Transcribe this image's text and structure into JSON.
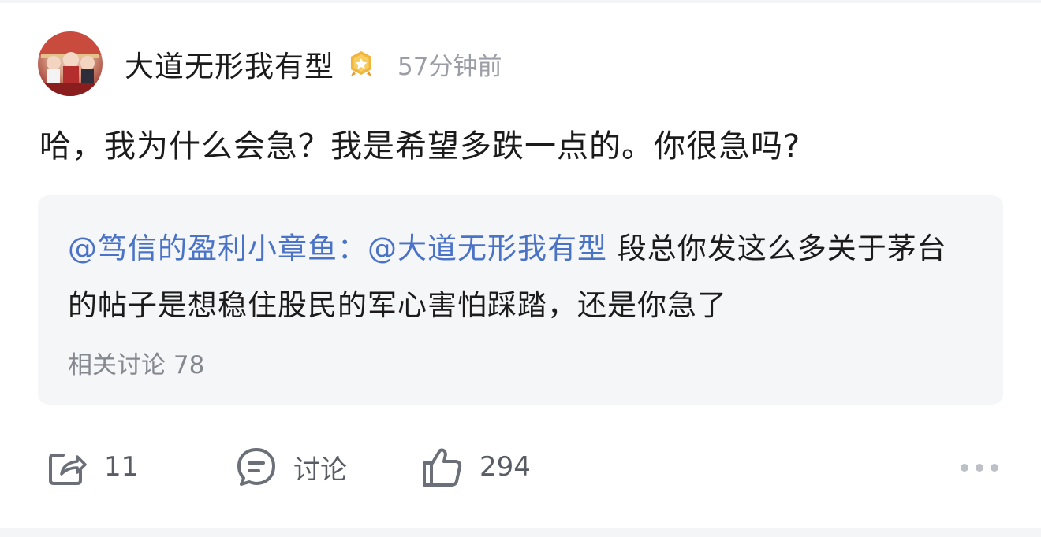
{
  "post": {
    "author": {
      "name": "大道无形我有型",
      "avatar_icon": "avatar-photo",
      "badge_icon": "vip-crown-badge-icon",
      "time": "57分钟前"
    },
    "content": "哈，我为什么会急？我是希望多跌一点的。你很急吗?",
    "quote": {
      "mention_1": "@笃信的盈利小章鱼：",
      "mention_2": "@大道无形我有型",
      "text": " 段总你发这么多关于茅台的帖子是想稳住股民的军心害怕踩踏，还是你急了",
      "related": "相关讨论 78"
    },
    "actions": {
      "share_count": "11",
      "comment_label": "讨论",
      "like_count": "294"
    },
    "colors": {
      "mention": "#4a73c7",
      "card_bg": "#f5f6f8",
      "muted": "#9b9ea6",
      "badge": "#f1b53b"
    }
  }
}
